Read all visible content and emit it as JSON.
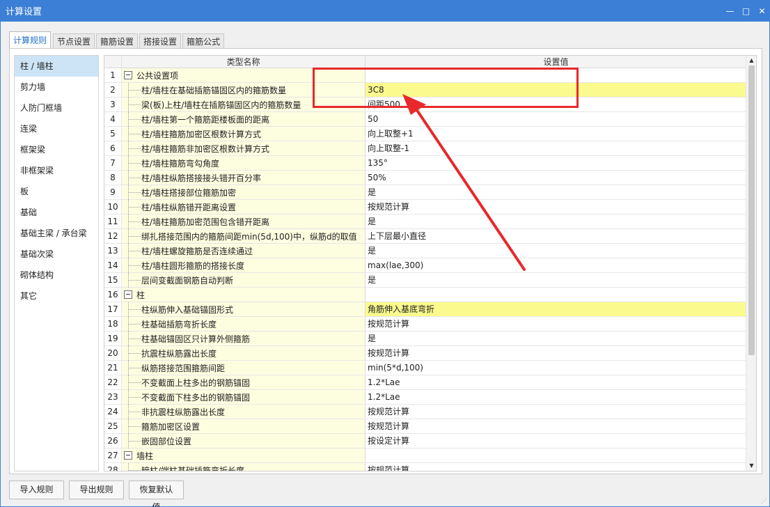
{
  "window": {
    "title": "计算设置",
    "controls": [
      "—",
      "□",
      "✕"
    ]
  },
  "tabs": [
    {
      "label": "计算规则",
      "active": true
    },
    {
      "label": "节点设置",
      "active": false
    },
    {
      "label": "箍筋设置",
      "active": false
    },
    {
      "label": "搭接设置",
      "active": false
    },
    {
      "label": "箍筋公式",
      "active": false
    }
  ],
  "sidebar": {
    "items": [
      {
        "label": "柱 / 墙柱",
        "selected": true
      },
      {
        "label": "剪力墙"
      },
      {
        "label": "人防门框墙"
      },
      {
        "label": "连梁"
      },
      {
        "label": "框架梁"
      },
      {
        "label": "非框架梁"
      },
      {
        "label": "板"
      },
      {
        "label": "基础"
      },
      {
        "label": "基础主梁 / 承台梁"
      },
      {
        "label": "基础次梁"
      },
      {
        "label": "砌体结构"
      },
      {
        "label": "其它"
      }
    ]
  },
  "grid": {
    "headers": {
      "name": "类型名称",
      "value": "设置值"
    },
    "rows": [
      {
        "num": "1",
        "name": "公共设置项",
        "value": "",
        "group": true
      },
      {
        "num": "2",
        "name": "柱/墙柱在基础插筋锚固区内的箍筋数量",
        "value": "3C8",
        "highlight": true
      },
      {
        "num": "3",
        "name": "梁(板)上柱/墙柱在插筋锚固区内的箍筋数量",
        "value": "间距500"
      },
      {
        "num": "4",
        "name": "柱/墙柱第一个箍筋距楼板面的距离",
        "value": "50"
      },
      {
        "num": "5",
        "name": "柱/墙柱箍筋加密区根数计算方式",
        "value": "向上取整+1"
      },
      {
        "num": "6",
        "name": "柱/墙柱箍筋非加密区根数计算方式",
        "value": "向上取整-1"
      },
      {
        "num": "7",
        "name": "柱/墙柱箍筋弯勾角度",
        "value": "135°"
      },
      {
        "num": "8",
        "name": "柱/墙柱纵筋搭接接头错开百分率",
        "value": "50%"
      },
      {
        "num": "9",
        "name": "柱/墙柱搭接部位箍筋加密",
        "value": "是"
      },
      {
        "num": "10",
        "name": "柱/墙柱纵筋错开距离设置",
        "value": "按规范计算"
      },
      {
        "num": "11",
        "name": "柱/墙柱箍筋加密范围包含错开距离",
        "value": "是"
      },
      {
        "num": "12",
        "name": "绑扎搭接范围内的箍筋间距min(5d,100)中，纵筋d的取值",
        "value": "上下层最小直径"
      },
      {
        "num": "13",
        "name": "柱/墙柱螺旋箍筋是否连续通过",
        "value": "是"
      },
      {
        "num": "14",
        "name": "柱/墙柱圆形箍筋的搭接长度",
        "value": "max(lae,300)"
      },
      {
        "num": "15",
        "name": "层间变截面钢筋自动判断",
        "value": "是"
      },
      {
        "num": "16",
        "name": "柱",
        "value": "",
        "group": true
      },
      {
        "num": "17",
        "name": "柱纵筋伸入基础锚固形式",
        "value": "角筋伸入基底弯折",
        "highlight": true
      },
      {
        "num": "18",
        "name": "柱基础插筋弯折长度",
        "value": "按规范计算"
      },
      {
        "num": "19",
        "name": "柱基础锚固区只计算外侧箍筋",
        "value": "是"
      },
      {
        "num": "20",
        "name": "抗震柱纵筋露出长度",
        "value": "按规范计算"
      },
      {
        "num": "21",
        "name": "纵筋搭接范围箍筋间距",
        "value": "min(5*d,100)"
      },
      {
        "num": "22",
        "name": "不变截面上柱多出的钢筋锚固",
        "value": "1.2*Lae"
      },
      {
        "num": "23",
        "name": "不变截面下柱多出的钢筋锚固",
        "value": "1.2*Lae"
      },
      {
        "num": "24",
        "name": "非抗震柱纵筋露出长度",
        "value": "按规范计算"
      },
      {
        "num": "25",
        "name": "箍筋加密区设置",
        "value": "按规范计算"
      },
      {
        "num": "26",
        "name": "嵌固部位设置",
        "value": "按设定计算"
      },
      {
        "num": "27",
        "name": "墙柱",
        "value": "",
        "group": true
      },
      {
        "num": "28",
        "name": "暗柱/端柱基础插筋弯折长度",
        "value": "按规范计算"
      }
    ]
  },
  "buttons": {
    "import": "导入规则",
    "export": "导出规则",
    "restore": "恢复默认值"
  },
  "annotation": {
    "color": "#e8282b"
  }
}
